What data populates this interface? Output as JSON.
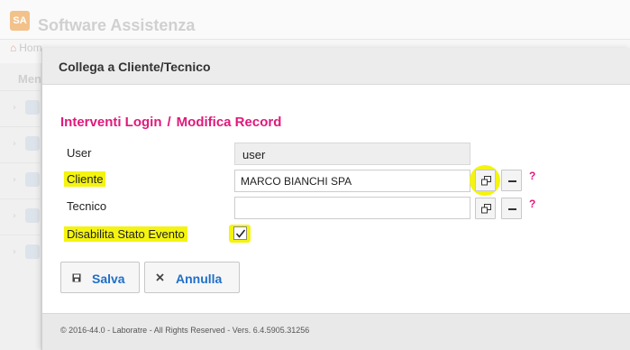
{
  "background": {
    "app_title": "Software Assistenza",
    "logo_text": "SA",
    "breadcrumb": "Hom",
    "menu_label": "Men"
  },
  "modal": {
    "title": "Collega a Cliente/Tecnico",
    "breadcrumb_left": "Interventi Login",
    "breadcrumb_sep": "/",
    "breadcrumb_right": "Modifica Record",
    "fields": {
      "user": {
        "label": "User",
        "value": "user"
      },
      "cliente": {
        "label": "Cliente",
        "value": "MARCO BIANCHI SPA",
        "help": "?"
      },
      "tecnico": {
        "label": "Tecnico",
        "value": "",
        "help": "?"
      },
      "disabilita": {
        "label": "Disabilita Stato Evento",
        "checked": true
      }
    },
    "buttons": {
      "save": "Salva",
      "cancel": "Annulla"
    },
    "footer": "© 2016-44.0 - Laboratre - All Rights Reserved - Vers. 6.4.5905.31256"
  },
  "colors": {
    "accent_pink": "#e0197b",
    "link_blue": "#1f6fc8",
    "highlight_yellow": "#f4f410"
  }
}
